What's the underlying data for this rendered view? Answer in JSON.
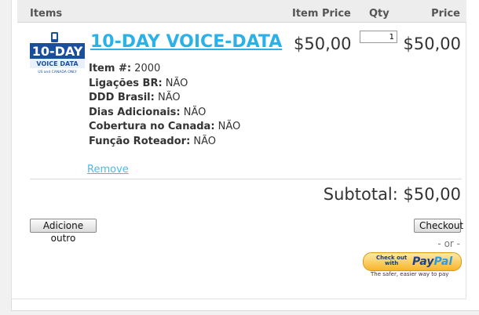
{
  "header": {
    "items": "Items",
    "item_price": "Item Price",
    "qty": "Qty",
    "price": "Price"
  },
  "item": {
    "thumb": {
      "line1": "10-DAY",
      "line2": "VOICE DATA",
      "line3": "US and CANADA ONLY"
    },
    "name": "10-DAY VOICE-DATA",
    "unit_price": "$50,00",
    "qty": "1",
    "line_total": "$50,00",
    "attributes": [
      {
        "key": "Item #:",
        "value": "2000"
      },
      {
        "key": "Ligações BR:",
        "value": "NÃO"
      },
      {
        "key": "DDD Brasil:",
        "value": "NÃO"
      },
      {
        "key": "Dias Adicionais:",
        "value": "NÃO"
      },
      {
        "key": "Cobertura no Canada:",
        "value": "NÃO"
      },
      {
        "key": "Função Roteador:",
        "value": "NÃO"
      }
    ],
    "remove_label": "Remove"
  },
  "subtotal": "Subtotal: $50,00",
  "buttons": {
    "add_other": "Adicione outro",
    "checkout": "Checkout"
  },
  "or_text": "- or -",
  "paypal": {
    "checkout_text_1": "Check out",
    "checkout_text_2": "with",
    "logo_pay": "Pay",
    "logo_pal": "Pal",
    "tagline": "The safer, easier way to pay"
  },
  "colors": {
    "link": "#2bb0e8",
    "header_bg": "#ededed",
    "paypal_yellow": "#f7b52a",
    "paypal_blue": "#1e3f8f"
  }
}
